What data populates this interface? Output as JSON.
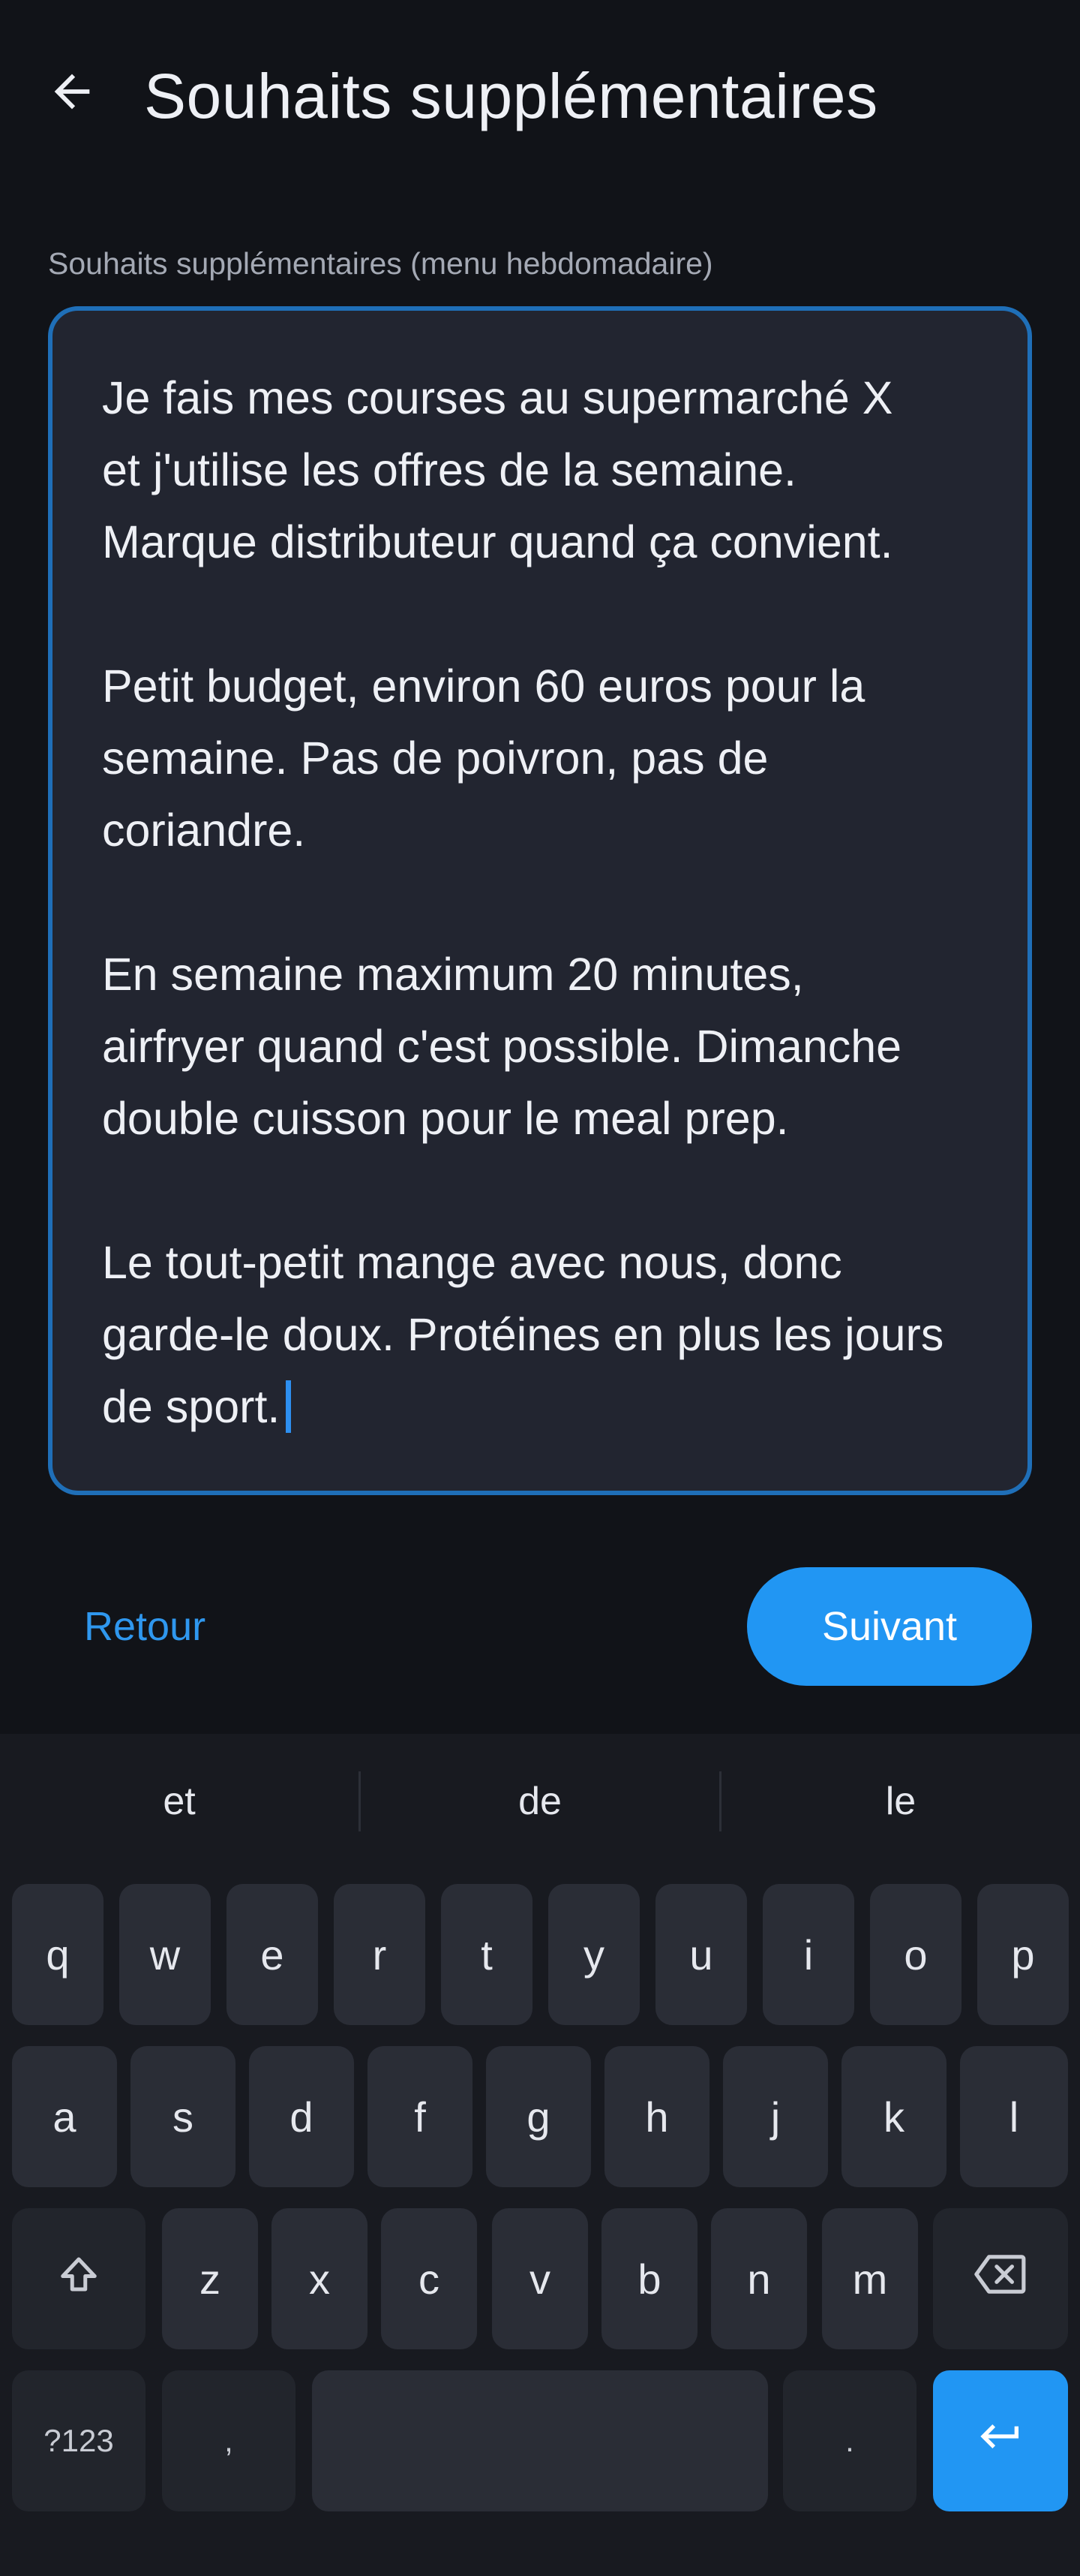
{
  "header": {
    "title": "Souhaits supplémentaires",
    "back_icon": "arrow-left-icon"
  },
  "field": {
    "label": "Souhaits supplémentaires (menu hebdomadaire)",
    "value": "Je fais mes courses au supermarché X\net j'utilise les offres de la semaine.\nMarque distributeur quand ça convient.\n\nPetit budget, environ 60 euros pour la\nsemaine. Pas de poivron, pas de\ncoriandre.\n\nEn semaine maximum 20 minutes,\nairfryer quand c'est possible. Dimanche\ndouble cuisson pour le meal prep.\n\nLe tout-petit mange avec nous, donc\ngarde-le doux. Protéines en plus les jours\nde sport."
  },
  "actions": {
    "back_label": "Retour",
    "next_label": "Suivant"
  },
  "keyboard": {
    "suggestions": [
      "et",
      "de",
      "le"
    ],
    "row1": [
      "q",
      "w",
      "e",
      "r",
      "t",
      "y",
      "u",
      "i",
      "o",
      "p"
    ],
    "row2": [
      "a",
      "s",
      "d",
      "f",
      "g",
      "h",
      "j",
      "k",
      "l"
    ],
    "row3": [
      "z",
      "x",
      "c",
      "v",
      "b",
      "n",
      "m"
    ],
    "symbols_label": "?123",
    "comma_label": ",",
    "period_label": ".",
    "shift_icon": "shift-icon",
    "backspace_icon": "backspace-icon",
    "enter_icon": "enter-icon"
  },
  "colors": {
    "background": "#111318",
    "accent": "#2196f3",
    "field_border": "#1f6fb8",
    "field_background": "#222530",
    "keyboard_background": "#181a20",
    "key_background": "#2a2d36"
  }
}
